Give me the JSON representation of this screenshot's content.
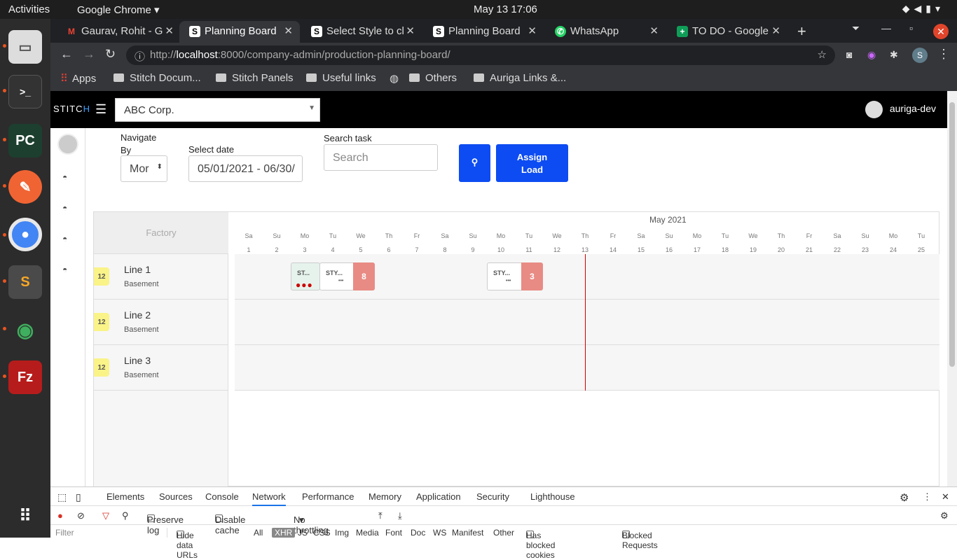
{
  "system": {
    "activities": "Activities",
    "app": "Google Chrome ▾",
    "clock": "May 13  17:06"
  },
  "browser": {
    "tabs": [
      {
        "label": "Gaurav, Rohit - G"
      },
      {
        "label": "Planning Board"
      },
      {
        "label": "Select Style to cl"
      },
      {
        "label": "Planning Board"
      },
      {
        "label": "WhatsApp"
      },
      {
        "label": "TO DO - Google"
      }
    ],
    "url_prefix": "http://",
    "url_host": "localhost",
    "url_path": ":8000/company-admin/production-planning-board/",
    "bookmarks": {
      "apps": "Apps",
      "b1": "Stitch Docum...",
      "b2": "Stitch Panels",
      "b3": "Useful links",
      "b4": "Others",
      "b5": "Auriga Links &..."
    }
  },
  "app": {
    "logo_a": "STITC",
    "logo_b": "H",
    "company": "ABC Corp.",
    "user": "auriga-dev",
    "navigate_label": "Navigate By",
    "navigate_value": "Mor",
    "date_label": "Select date",
    "date_value": "05/01/2021 - 06/30/",
    "search_label": "Search task",
    "search_placeholder": "Search",
    "assign_line1": "Assign",
    "assign_line2": "Load",
    "board": {
      "factory_header": "Factory",
      "month": "May 2021",
      "days": [
        [
          "Sa",
          "1"
        ],
        [
          "Su",
          "2"
        ],
        [
          "Mo",
          "3"
        ],
        [
          "Tu",
          "4"
        ],
        [
          "We",
          "5"
        ],
        [
          "Th",
          "6"
        ],
        [
          "Fr",
          "7"
        ],
        [
          "Sa",
          "8"
        ],
        [
          "Su",
          "9"
        ],
        [
          "Mo",
          "10"
        ],
        [
          "Tu",
          "11"
        ],
        [
          "We",
          "12"
        ],
        [
          "Th",
          "13"
        ],
        [
          "Fr",
          "14"
        ],
        [
          "Sa",
          "15"
        ],
        [
          "Su",
          "16"
        ],
        [
          "Mo",
          "17"
        ],
        [
          "Tu",
          "18"
        ],
        [
          "We",
          "19"
        ],
        [
          "Th",
          "20"
        ],
        [
          "Fr",
          "21"
        ],
        [
          "Sa",
          "22"
        ],
        [
          "Su",
          "23"
        ],
        [
          "Mo",
          "24"
        ],
        [
          "Tu",
          "25"
        ]
      ],
      "lines": [
        {
          "badge": "12",
          "name": "Line 1",
          "location": "Basement"
        },
        {
          "badge": "12",
          "name": "Line 2",
          "location": "Basement"
        },
        {
          "badge": "12",
          "name": "Line 3",
          "location": "Basement"
        }
      ],
      "tasks": {
        "t1": "ST...",
        "t2": "STY...",
        "t2_dots": "•••",
        "q1": "8",
        "t3": "STY...",
        "t3_dots": "•••",
        "q2": "3"
      }
    }
  },
  "devtools": {
    "tabs": [
      "Elements",
      "Sources",
      "Console",
      "Network",
      "Performance",
      "Memory",
      "Application",
      "Security",
      "Lighthouse"
    ],
    "preserve": "Preserve log",
    "disable": "Disable cache",
    "throttle": "No throttling",
    "filter": "Filter",
    "hide": "Hide data URLs",
    "all": "All",
    "xhr": "XHR",
    "types": [
      "JS",
      "CSS",
      "Img",
      "Media",
      "Font",
      "Doc",
      "WS",
      "Manifest",
      "Other"
    ],
    "blocked_cookies": "Has blocked cookies",
    "blocked_req": "Blocked Requests"
  }
}
